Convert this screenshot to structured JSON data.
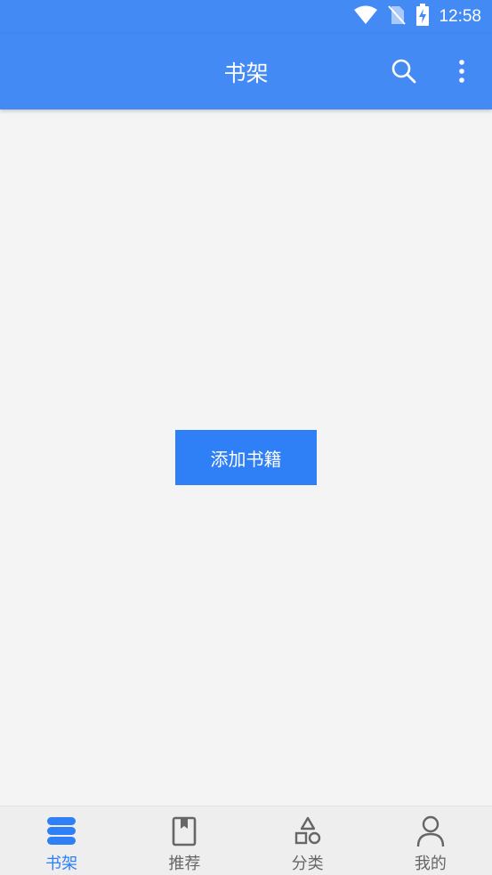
{
  "status_bar": {
    "time": "12:58",
    "icons": [
      "wifi-icon",
      "no-sim-icon",
      "battery-charging-icon"
    ]
  },
  "app_bar": {
    "title": "书架",
    "actions": [
      "search-icon",
      "more-vert-icon"
    ]
  },
  "main": {
    "add_book_label": "添加书籍"
  },
  "bottom_nav": {
    "items": [
      {
        "label": "书架",
        "icon": "bookshelf-icon",
        "active": true
      },
      {
        "label": "推荐",
        "icon": "book-icon",
        "active": false
      },
      {
        "label": "分类",
        "icon": "category-shapes-icon",
        "active": false
      },
      {
        "label": "我的",
        "icon": "person-icon",
        "active": false
      }
    ]
  },
  "colors": {
    "primary": "#438af5",
    "button": "#2f7ff6",
    "background": "#f4f4f4",
    "nav_inactive": "#666666"
  }
}
